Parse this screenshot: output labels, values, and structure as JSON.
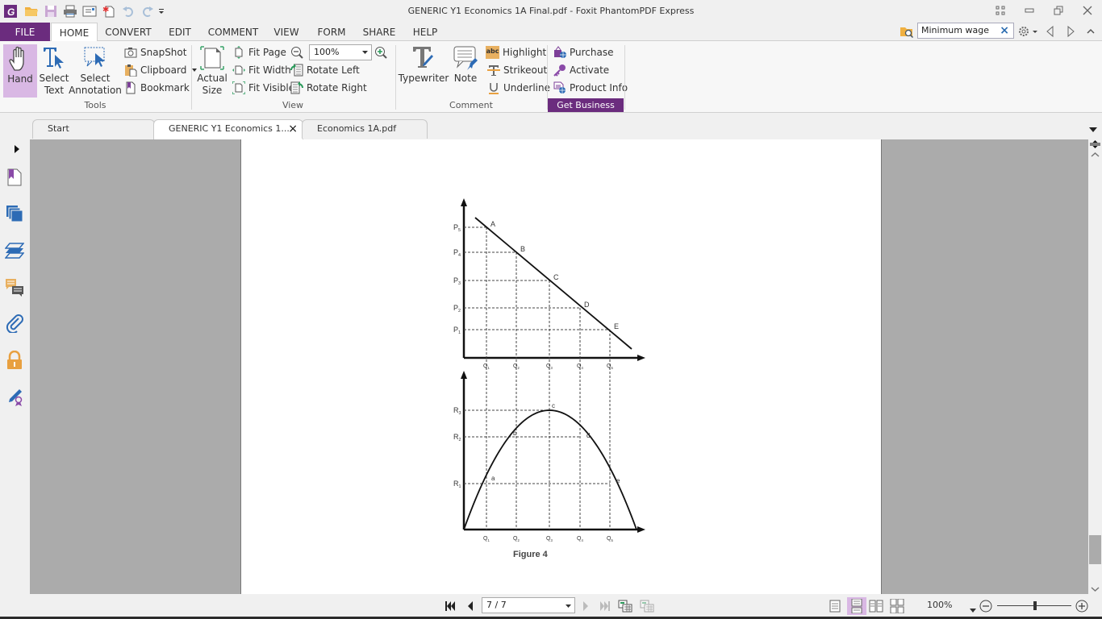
{
  "window": {
    "title": "GENERIC Y1 Economics 1A Final.pdf - Foxit PhantomPDF Express"
  },
  "quick_access": [
    "app-logo",
    "open",
    "save",
    "print",
    "email",
    "new-document",
    "undo",
    "redo",
    "customize"
  ],
  "menu": {
    "file": "FILE",
    "tabs": [
      "HOME",
      "CONVERT",
      "EDIT",
      "COMMENT",
      "VIEW",
      "FORM",
      "SHARE",
      "HELP"
    ],
    "active_tab": "HOME"
  },
  "search": {
    "value": "Minimum wage",
    "clear_label": "×"
  },
  "ribbon": {
    "tools": {
      "label": "Tools",
      "hand": "Hand",
      "select_text_1": "Select",
      "select_text_2": "Text",
      "select_annotation_1": "Select",
      "select_annotation_2": "Annotation",
      "snapshot": "SnapShot",
      "clipboard": "Clipboard",
      "bookmark": "Bookmark"
    },
    "view": {
      "label": "View",
      "actual_size_1": "Actual",
      "actual_size_2": "Size",
      "fit_page": "Fit Page",
      "fit_width": "Fit Width",
      "fit_visible": "Fit Visible",
      "zoom_value": "100%",
      "rotate_left": "Rotate Left",
      "rotate_right": "Rotate Right"
    },
    "comment": {
      "label": "Comment",
      "typewriter": "Typewriter",
      "note": "Note",
      "highlight": "Highlight",
      "strikeout": "Strikeout",
      "underline": "Underline"
    },
    "business": {
      "purchase": "Purchase",
      "activate": "Activate",
      "product_info": "Product Info",
      "get_business": "Get Business"
    }
  },
  "doc_tabs": [
    {
      "label": "Start",
      "active": false
    },
    {
      "label": "GENERIC Y1 Economics 1...",
      "active": true,
      "close": "×"
    },
    {
      "label": "Economics 1A.pdf",
      "active": false
    }
  ],
  "left_panel": [
    "expand",
    "bookmarks",
    "pages",
    "layers",
    "comments",
    "attachments",
    "security",
    "signatures"
  ],
  "figure": {
    "caption": "Figure 4",
    "demand": {
      "price_labels": [
        "P5",
        "P4",
        "P3",
        "P2",
        "P1"
      ],
      "point_labels": [
        "A",
        "B",
        "C",
        "D",
        "E"
      ],
      "q_labels": [
        "Q1",
        "Q2",
        "Q3",
        "Q4",
        "Q5"
      ]
    },
    "revenue": {
      "r_labels": [
        "R3",
        "R2",
        "R1"
      ],
      "point_labels": [
        "a",
        "b",
        "c",
        "d",
        "e"
      ],
      "q_labels": [
        "Q1",
        "Q2",
        "Q3",
        "Q4",
        "Q5"
      ]
    }
  },
  "status": {
    "page_value": "7 / 7",
    "zoom_value": "100%",
    "zoom_slider_fraction": 0.5
  },
  "colors": {
    "brand": "#6b2c7e",
    "selected": "#d9b8e4",
    "viewer_bg": "#ababab"
  }
}
